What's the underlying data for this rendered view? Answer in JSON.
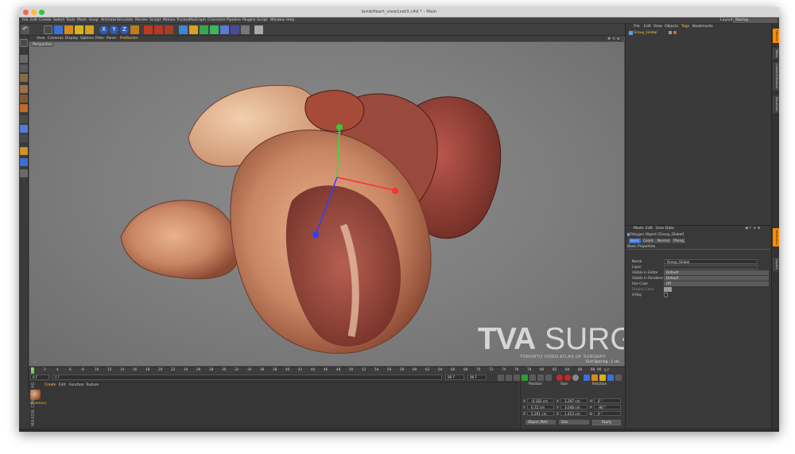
{
  "window": {
    "title": "lambHeart_view1set3.c4d * - Main"
  },
  "menu": [
    "File",
    "Edit",
    "Create",
    "Select",
    "Tools",
    "Mesh",
    "Snap",
    "Animate",
    "Simulate",
    "Render",
    "Sculpt",
    "Motion Tracker",
    "MoGraph",
    "Character",
    "Pipeline",
    "Plugins",
    "Script",
    "Window",
    "Help"
  ],
  "layout": {
    "label": "Layout:",
    "value": "Startup"
  },
  "toolbar_icons": [
    "undo-icon",
    "select-icon",
    "move-icon",
    "scale-icon",
    "rotate-icon",
    "plus-icon",
    "x-axis-icon",
    "y-axis-icon",
    "z-axis-icon",
    "coordinate-icon",
    "render-view-icon",
    "render-picture-icon",
    "render-settings-icon",
    "cube-icon",
    "pen-icon",
    "subdivision-icon",
    "array-icon",
    "deformer-icon",
    "scene-icon",
    "camera-icon",
    "light-icon"
  ],
  "viewport": {
    "menu": [
      "View",
      "Cameras",
      "Display",
      "Options",
      "Filter",
      "Panel",
      "ProRender"
    ],
    "name": "Perspective",
    "grid_spacing": "Grid Spacing : 1 cm"
  },
  "logo": {
    "main_a": "TVA",
    "main_b": "SURG",
    "sub": "TORONTO VIDEO ATLAS OF SURGERY"
  },
  "timeline": {
    "ticks": [
      "0",
      "2",
      "4",
      "6",
      "8",
      "10",
      "12",
      "14",
      "16",
      "18",
      "20",
      "22",
      "24",
      "26",
      "28",
      "30",
      "32",
      "34",
      "36",
      "38",
      "40",
      "42",
      "44",
      "46",
      "48",
      "50",
      "52",
      "54",
      "56",
      "58",
      "60",
      "62",
      "64",
      "66",
      "68",
      "70",
      "72",
      "74",
      "76",
      "78",
      "80",
      "82",
      "84",
      "86",
      "88",
      "90"
    ],
    "end": "0 F"
  },
  "frames": {
    "start": "0 F",
    "current": "0 F",
    "end": "90 F",
    "max": "90 F"
  },
  "material_manager": {
    "menu": [
      "Create",
      "Edit",
      "Function",
      "Texture"
    ],
    "material_name": "lambHeart",
    "brand": "MAXON CINEMA 4D"
  },
  "coordinates": {
    "headers": [
      "Position",
      "Size",
      "Rotation"
    ],
    "rows": [
      {
        "axis": "X",
        "pos": "-0.182 cm",
        "size_axis": "X",
        "size": "3.297 cm",
        "rot_axis": "H",
        "rot": "0 °"
      },
      {
        "axis": "Y",
        "pos": "6.72 cm",
        "size_axis": "Y",
        "size": "3.046 cm",
        "rot_axis": "P",
        "rot": "-90 °"
      },
      {
        "axis": "Z",
        "pos": "5.291 cm",
        "size_axis": "Z",
        "size": "1.453 cm",
        "rot_axis": "B",
        "rot": "0 °"
      }
    ],
    "mode_dropdown": "Object (Rel)",
    "size_dropdown": "Size",
    "apply": "Apply"
  },
  "object_manager": {
    "menu": [
      "File",
      "Edit",
      "View",
      "Objects",
      "Tags",
      "Bookmarks"
    ],
    "object_name": "Group_Global"
  },
  "attributes": {
    "menu": [
      "Mode",
      "Edit",
      "User Data"
    ],
    "title": "Polygon Object [Group_Global]",
    "tabs": [
      "Basic",
      "Coord.",
      "Normal",
      "Phong"
    ],
    "section": "Basic Properties",
    "props": [
      {
        "label": "Name",
        "value": "Group_Global"
      },
      {
        "label": "Layer",
        "value": ""
      },
      {
        "label": "Visible in Editor",
        "value": "Default"
      },
      {
        "label": "Visible in Renderer",
        "value": "Default"
      },
      {
        "label": "Use Color",
        "value": "Off"
      },
      {
        "label": "Display Color",
        "value": ""
      },
      {
        "label": "X-Ray",
        "value": ""
      }
    ]
  },
  "side_tabs": [
    "Objects",
    "Takes",
    "Content Browser",
    "Structure"
  ],
  "side_tabs_lower": [
    "Attributes",
    "Layers"
  ],
  "colors": {
    "active_menu": "#ffc341",
    "accent_orange": "#ff8c00",
    "viewport_bg": "#7f7f7f",
    "axis_x": "#ff3030",
    "axis_y": "#30e030",
    "axis_z": "#3040ff"
  }
}
